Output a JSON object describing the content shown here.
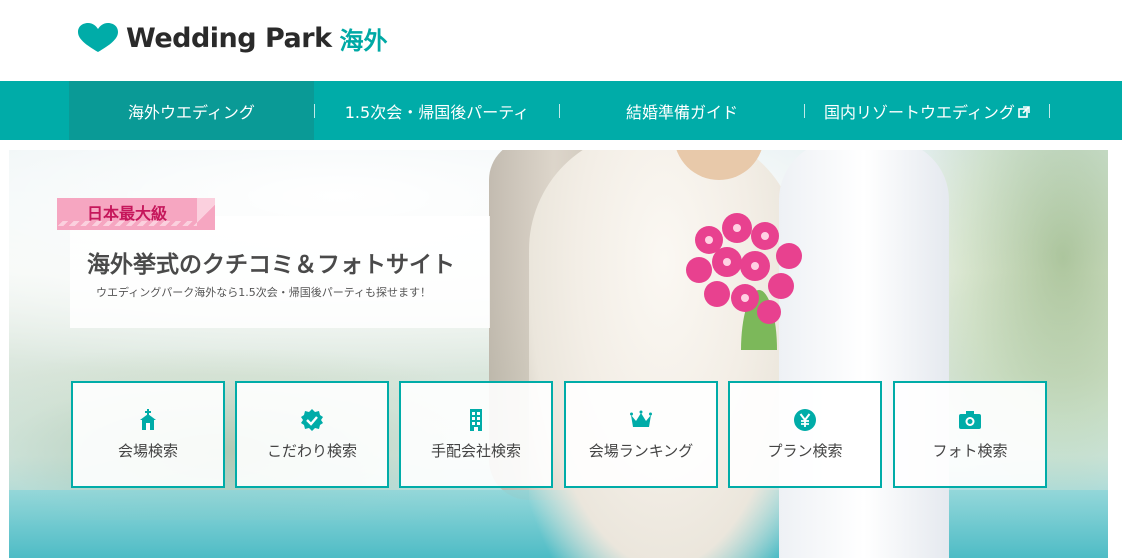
{
  "header": {
    "logo_text": "Wedding Park",
    "logo_sub": "海外",
    "logo_color": "#00a9a5"
  },
  "nav": {
    "items": [
      {
        "label": "海外ウエディング",
        "active": true
      },
      {
        "label": "1.5次会・帰国後パーティ",
        "active": false
      },
      {
        "label": "結婚準備ガイド",
        "active": false
      },
      {
        "label": "国内リゾートウエディング",
        "active": false,
        "icon": "external-link-icon"
      }
    ],
    "background": "#00aca8"
  },
  "hero": {
    "ribbon": "日本最大級",
    "title": "海外挙式のクチコミ＆フォトサイト",
    "subtitle": "ウエディングパーク海外なら1.5次会・帰国後パーティも探せます！"
  },
  "search": {
    "buttons": [
      {
        "label": "会場検索",
        "icon": "chapel-icon"
      },
      {
        "label": "こだわり検索",
        "icon": "check-badge-icon"
      },
      {
        "label": "手配会社検索",
        "icon": "building-icon"
      },
      {
        "label": "会場ランキング",
        "icon": "crown-icon"
      },
      {
        "label": "プラン検索",
        "icon": "yen-icon"
      },
      {
        "label": "フォト検索",
        "icon": "camera-icon"
      }
    ]
  }
}
